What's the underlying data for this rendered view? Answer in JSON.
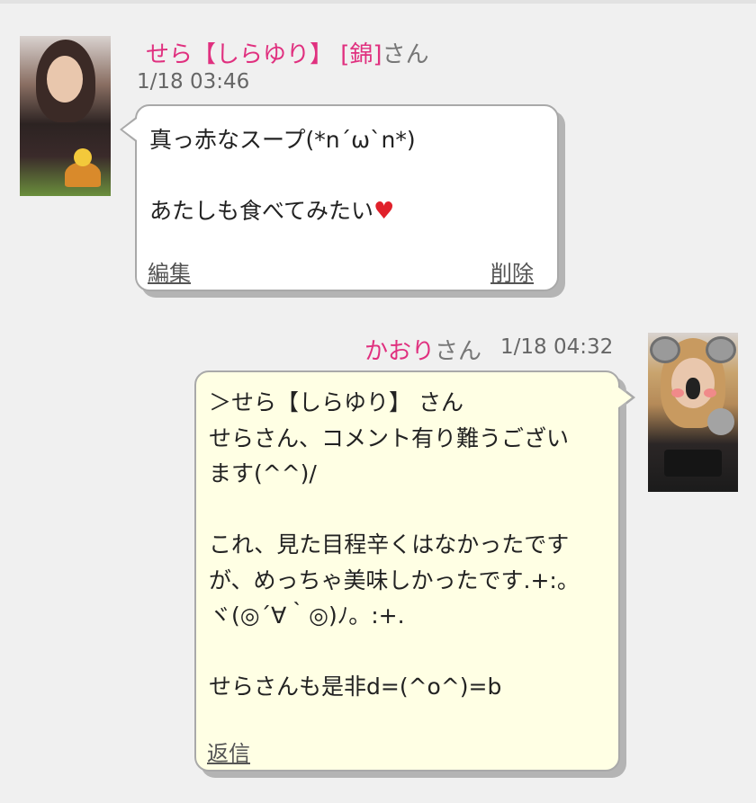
{
  "messages": [
    {
      "author_name": "せら【しらゆり】",
      "author_badge": "[錦]",
      "author_suffix": "さん",
      "timestamp": "1/18 03:46",
      "lines": [
        "真っ赤なスープ(*n´ω`n*)",
        "",
        "あたしも食べてみたい"
      ],
      "heart": "♥",
      "actions": {
        "edit": "編集",
        "delete": "削除"
      }
    },
    {
      "author_name": "かおり",
      "author_suffix": "さん",
      "timestamp": "1/18 04:32",
      "lines": [
        "＞せら【しらゆり】 さん",
        "せらさん、コメント有り難うござい",
        "ます(^^)/",
        "",
        "これ、見た目程辛くはなかったです",
        "が、めっちゃ美味しかったです.+:。",
        "ヾ(◎´∀｀◎)ﾉ。:+.",
        "",
        "せらさんも是非d=(^o^)=b"
      ],
      "actions": {
        "reply": "返信"
      }
    }
  ],
  "colors": {
    "name_accent": "#e0307f",
    "bubble_own": "#ffffe4",
    "bubble_other": "#ffffff",
    "background": "#f0f0f0"
  }
}
